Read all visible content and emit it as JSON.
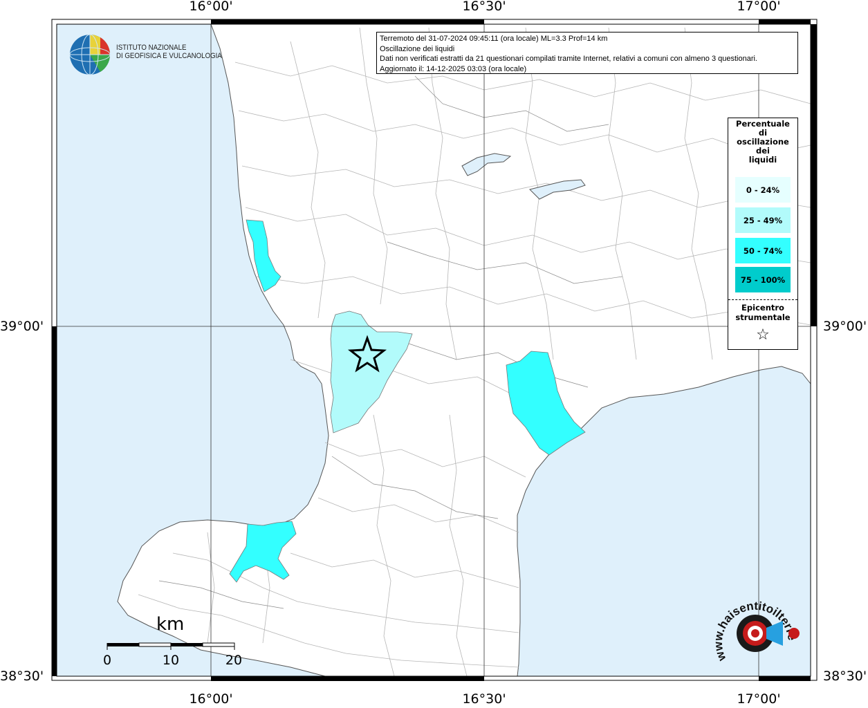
{
  "map": {
    "ticks_top": [
      "16°00'",
      "16°30'",
      "17°00'"
    ],
    "ticks_bottom": [
      "16°00'",
      "16°30'",
      "17°00'"
    ],
    "ticks_left": [
      "39°00'",
      "38°30'"
    ],
    "ticks_right": [
      "39°00'",
      "38°30'"
    ],
    "colors": {
      "sea": "#dff0fb",
      "land": "#ffffff",
      "class_0_24": "#e6ffff",
      "class_25_49": "#b2fbfb",
      "class_50_74": "#33ffff",
      "class_75_100": "#00cccc"
    }
  },
  "info": {
    "line1": "Terremoto del 31-07-2024 09:45:11 (ora locale) ML=3.3 Prof=14 km",
    "line2": "Oscillazione dei liquidi",
    "line3": "Dati non verificati estratti da 21 questionari compilati tramite Internet, relativi a comuni con almeno 3 questionari.",
    "line4": "Aggiornato il: 14-12-2025 03:03 (ora locale)"
  },
  "legend": {
    "title_lines": [
      "Percentuale",
      "di",
      "oscillazione",
      "dei",
      "liquidi"
    ],
    "classes": [
      {
        "label": "0 - 24%",
        "color": "#e6ffff"
      },
      {
        "label": "25 - 49%",
        "color": "#b2fbfb"
      },
      {
        "label": "50 - 74%",
        "color": "#33ffff"
      },
      {
        "label": "75 - 100%",
        "color": "#00cccc"
      }
    ],
    "epicenter_line1": "Epicentro",
    "epicenter_line2": "strumentale",
    "star_symbol": "☆"
  },
  "logo": {
    "line1": "ISTITUTO NAZIONALE",
    "line2": "DI GEOFISICA E VULCANOLOGIA"
  },
  "scale": {
    "unit": "km",
    "labels": [
      "0",
      "10",
      "20"
    ]
  },
  "watermark": {
    "text": "www.haisentitoilterremoto.it"
  }
}
